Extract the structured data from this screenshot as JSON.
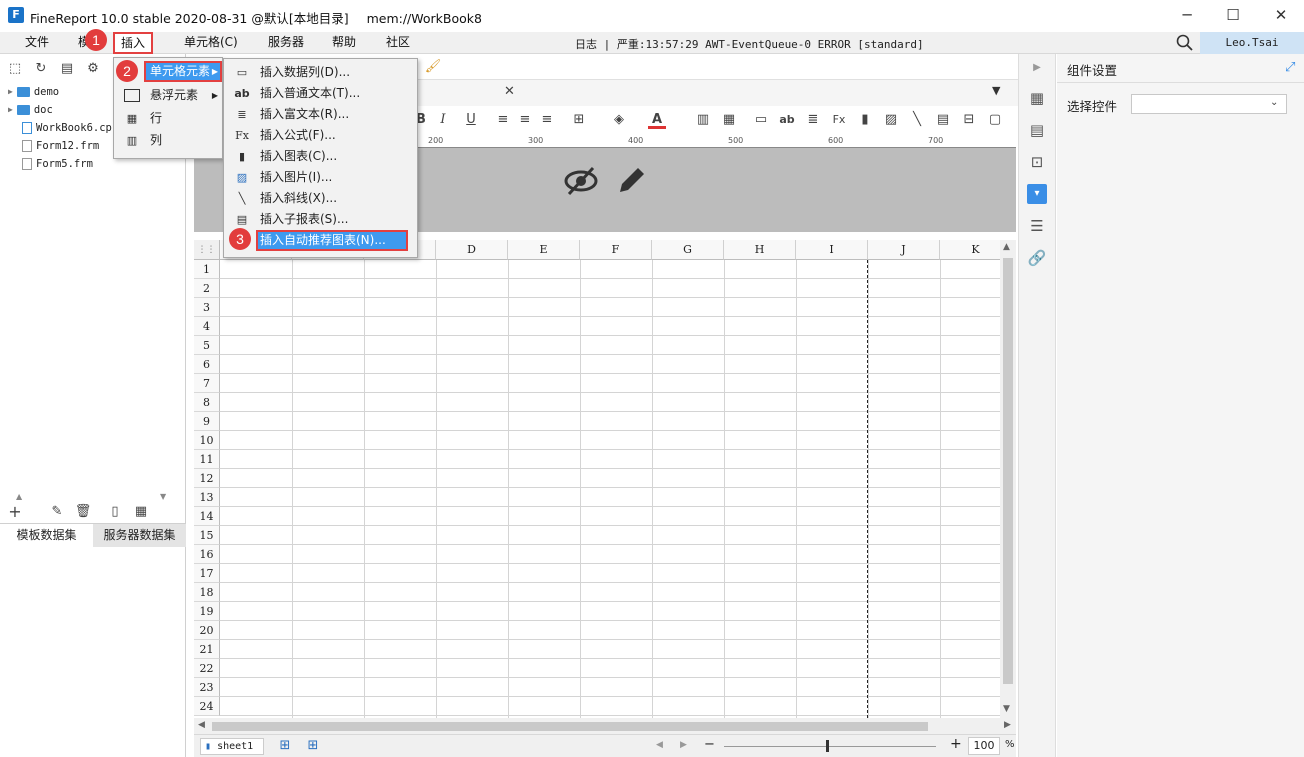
{
  "window": {
    "app_title": "FineReport 10.0 stable 2020-08-31 @默认[本地目录]",
    "doc_title": "mem://WorkBook8",
    "min_glyph": "─",
    "max_glyph": "☐",
    "close_glyph": "✕"
  },
  "menubar": {
    "items": [
      "文件",
      "模",
      "插入",
      "单元格(C)",
      "服务器",
      "帮助",
      "社区"
    ],
    "log": "日志 | 严重:13:57:29 AWT-EventQueue-0 ERROR [standard]",
    "user": "Leo.Tsai"
  },
  "file_tree": {
    "items": [
      "demo",
      "doc",
      "WorkBook6.cp",
      "Form12.frm",
      "Form5.frm"
    ]
  },
  "dataset_tabs": [
    "模板数据集",
    "服务器数据集"
  ],
  "insert_menu": {
    "items": [
      "单元格元素",
      "悬浮元素",
      "行",
      "列"
    ]
  },
  "cell_element_menu": {
    "items": [
      {
        "label": "插入数据列(D)...",
        "icon": "data-column-icon"
      },
      {
        "label": "插入普通文本(T)...",
        "icon": "text-icon"
      },
      {
        "label": "插入富文本(R)...",
        "icon": "rich-text-icon"
      },
      {
        "label": "插入公式(F)...",
        "icon": "formula-icon"
      },
      {
        "label": "插入图表(C)...",
        "icon": "chart-icon"
      },
      {
        "label": "插入图片(I)...",
        "icon": "image-icon"
      },
      {
        "label": "插入斜线(X)...",
        "icon": "slash-icon"
      },
      {
        "label": "插入子报表(S)...",
        "icon": "subreport-icon"
      },
      {
        "label": "插入自动推荐图表(N)...",
        "icon": "auto-chart-icon"
      }
    ]
  },
  "step_badges": [
    "1",
    "2",
    "3"
  ],
  "ruler_ticks": [
    "200",
    "300",
    "400",
    "500",
    "600",
    "700"
  ],
  "columns": [
    "D",
    "E",
    "F",
    "G",
    "H",
    "I",
    "J",
    "K"
  ],
  "rows": [
    "1",
    "2",
    "3",
    "4",
    "5",
    "6",
    "7",
    "8",
    "9",
    "10",
    "11",
    "12",
    "13",
    "14",
    "15",
    "16",
    "17",
    "18",
    "19",
    "20",
    "21",
    "22",
    "23",
    "24"
  ],
  "sheet": {
    "name": "sheet1",
    "zoom": "100",
    "zoom_unit": "%"
  },
  "right_panel": {
    "title": "组件设置",
    "control_label": "选择控件",
    "control_value": ""
  },
  "colors": {
    "accent": "#3a8ee6",
    "badge": "#e23c3c",
    "highlight": "#3e9aef"
  }
}
